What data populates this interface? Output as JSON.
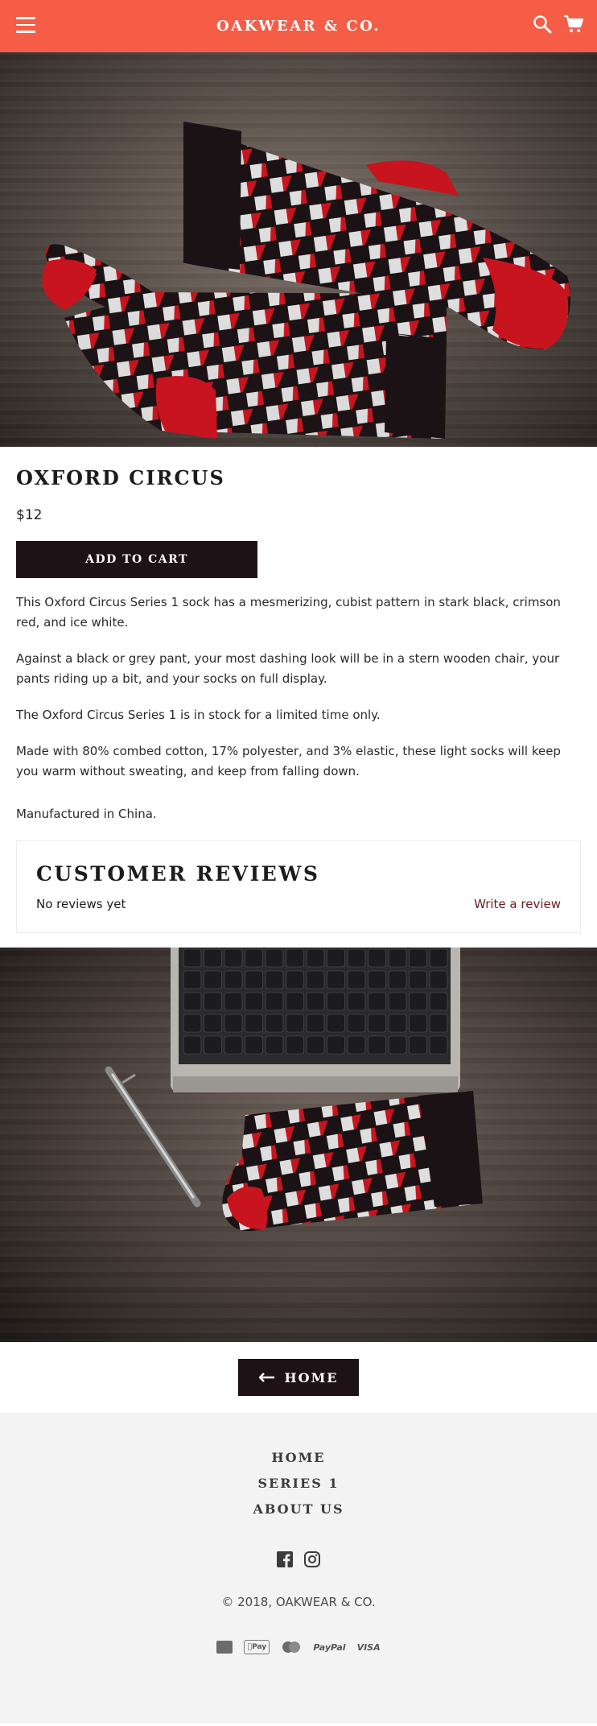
{
  "header": {
    "brand": "OAKWEAR & CO.",
    "menu_icon": "hamburger-menu-icon",
    "search_icon": "search-icon",
    "cart_icon": "cart-icon",
    "color": "#f55d47"
  },
  "product": {
    "title": "OXFORD CIRCUS",
    "price": "$12",
    "add_to_cart_label": "ADD TO CART",
    "description": [
      "This Oxford Circus Series 1 sock has a mesmerizing, cubist pattern in stark black, crimson red, and ice white.",
      "Against a black or grey pant, your most dashing look will be in a stern wooden chair, your pants riding up a bit, and your socks on full display.",
      "The Oxford Circus Series 1 is in stock for a limited time only.",
      "Made with 80% combed cotton, 17% polyester, and 3% elastic, these light socks will keep you warm without sweating, and keep from falling down.",
      "Manufactured in China."
    ]
  },
  "reviews": {
    "title": "CUSTOMER REVIEWS",
    "empty_text": "No reviews yet",
    "write_label": "Write a review"
  },
  "back_home": {
    "label": "HOME",
    "icon": "arrow-left-icon"
  },
  "footer": {
    "nav": [
      "HOME",
      "SERIES 1",
      "ABOUT US"
    ],
    "social_icons": [
      "facebook-icon",
      "instagram-icon"
    ],
    "copyright": "© 2018, OAKWEAR & CO.",
    "payments": [
      "American Express",
      "Apple Pay",
      "Mastercard",
      "PayPal",
      "VISA"
    ],
    "payment_labels": {
      "apple": "Pay",
      "paypal": "PayPal",
      "visa": "VISA"
    }
  },
  "colors": {
    "accent": "#f55d47",
    "button": "#1f1216",
    "review_link": "#6b1c1c",
    "sock_black": "#1a1214",
    "sock_red": "#c8141e",
    "sock_white": "#dedede"
  }
}
